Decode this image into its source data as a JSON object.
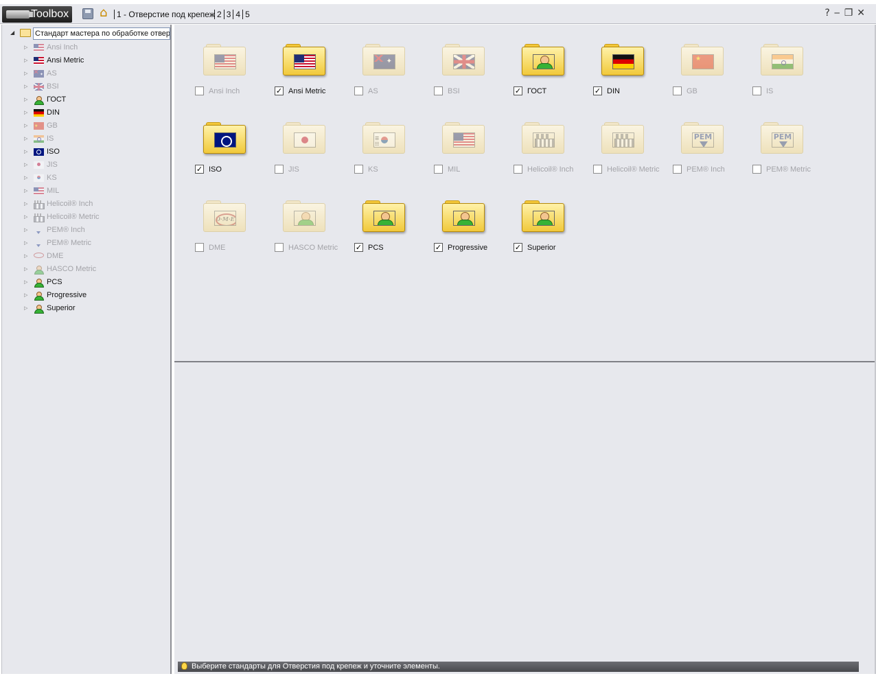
{
  "titlebar": {
    "app_name": "Toolbox",
    "breadcrumbs": [
      "1 - Отверстие под крепеж",
      "2",
      "3",
      "4",
      "5"
    ],
    "window_buttons": "?‒❐✕"
  },
  "tree": {
    "root_label": "Стандарт мастера по обработке отверстий",
    "items": [
      {
        "label": "Ansi Inch",
        "icon": "flag-us",
        "enabled": false
      },
      {
        "label": "Ansi Metric",
        "icon": "flag-us",
        "enabled": true
      },
      {
        "label": "AS",
        "icon": "flag-au",
        "enabled": false
      },
      {
        "label": "BSI",
        "icon": "flag-gb",
        "enabled": false
      },
      {
        "label": "ГОСТ",
        "icon": "person",
        "enabled": true
      },
      {
        "label": "DIN",
        "icon": "flag-de",
        "enabled": true
      },
      {
        "label": "GB",
        "icon": "flag-cn",
        "enabled": false
      },
      {
        "label": "IS",
        "icon": "flag-in",
        "enabled": false
      },
      {
        "label": "ISO",
        "icon": "iso",
        "enabled": true
      },
      {
        "label": "JIS",
        "icon": "flag-jp",
        "enabled": false
      },
      {
        "label": "KS",
        "icon": "flag-kr",
        "enabled": false
      },
      {
        "label": "MIL",
        "icon": "flag-us",
        "enabled": false
      },
      {
        "label": "Helicoil® Inch",
        "icon": "factory",
        "enabled": false
      },
      {
        "label": "Helicoil® Metric",
        "icon": "factory",
        "enabled": false
      },
      {
        "label": "PEM® Inch",
        "icon": "pem",
        "enabled": false
      },
      {
        "label": "PEM® Metric",
        "icon": "pem",
        "enabled": false
      },
      {
        "label": "DME",
        "icon": "dme",
        "enabled": false
      },
      {
        "label": "HASCO Metric",
        "icon": "person",
        "enabled": false
      },
      {
        "label": "PCS",
        "icon": "person",
        "enabled": true
      },
      {
        "label": "Progressive",
        "icon": "person",
        "enabled": true
      },
      {
        "label": "Superior",
        "icon": "person",
        "enabled": true
      }
    ]
  },
  "standards": [
    {
      "label": "Ansi Inch",
      "emblem": "us",
      "checked": false
    },
    {
      "label": "Ansi Metric",
      "emblem": "us",
      "checked": true
    },
    {
      "label": "AS",
      "emblem": "au",
      "checked": false
    },
    {
      "label": "BSI",
      "emblem": "gb",
      "checked": false
    },
    {
      "label": "ГОСТ",
      "emblem": "person",
      "checked": true
    },
    {
      "label": "DIN",
      "emblem": "de",
      "checked": true
    },
    {
      "label": "GB",
      "emblem": "cn",
      "checked": false
    },
    {
      "label": "IS",
      "emblem": "in",
      "checked": false
    },
    {
      "label": "ISO",
      "emblem": "iso",
      "checked": true
    },
    {
      "label": "JIS",
      "emblem": "jp",
      "checked": false
    },
    {
      "label": "KS",
      "emblem": "kr",
      "checked": false
    },
    {
      "label": "MIL",
      "emblem": "us",
      "checked": false
    },
    {
      "label": "Helicoil® Inch",
      "emblem": "factory",
      "checked": false
    },
    {
      "label": "Helicoil® Metric",
      "emblem": "factory",
      "checked": false
    },
    {
      "label": "PEM® Inch",
      "emblem": "pem",
      "checked": false
    },
    {
      "label": "PEM® Metric",
      "emblem": "pem",
      "checked": false
    },
    {
      "label": "DME",
      "emblem": "dme",
      "checked": false
    },
    {
      "label": "HASCO Metric",
      "emblem": "person",
      "checked": false
    },
    {
      "label": "PCS",
      "emblem": "person",
      "checked": true
    },
    {
      "label": "Progressive",
      "emblem": "person",
      "checked": true
    },
    {
      "label": "Superior",
      "emblem": "person",
      "checked": true
    }
  ],
  "emblem_text": {
    "pem": "PEM",
    "dme": "D·M·E"
  },
  "status": {
    "message": "Выберите стандарты для Отверстия под крепеж и уточните элементы."
  }
}
